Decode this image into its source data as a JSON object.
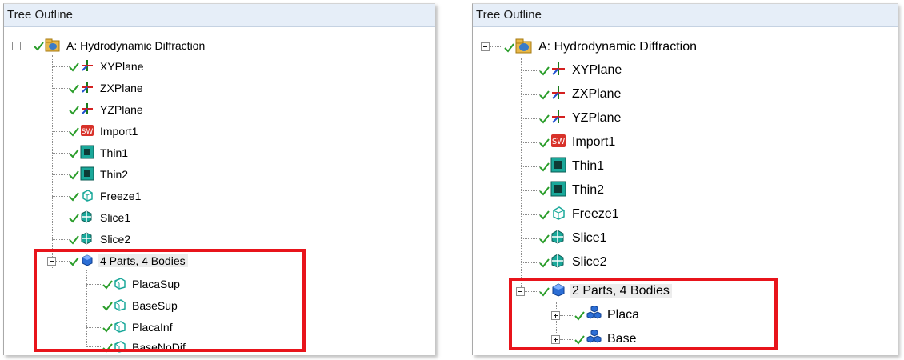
{
  "left_panel": {
    "title": "Tree Outline",
    "root_label": "A: Hydrodynamic Diffraction",
    "items": [
      {
        "label": "XYPlane",
        "icon": "plane-axes-icon"
      },
      {
        "label": "ZXPlane",
        "icon": "plane-axes-icon"
      },
      {
        "label": "YZPlane",
        "icon": "plane-axes-icon"
      },
      {
        "label": "Import1",
        "icon": "import-icon"
      },
      {
        "label": "Thin1",
        "icon": "thin-icon"
      },
      {
        "label": "Thin2",
        "icon": "thin-icon"
      },
      {
        "label": "Freeze1",
        "icon": "freeze-icon"
      },
      {
        "label": "Slice1",
        "icon": "slice-icon"
      },
      {
        "label": "Slice2",
        "icon": "slice-icon"
      }
    ],
    "parts_label": "4 Parts, 4 Bodies",
    "bodies": [
      {
        "label": "PlacaSup",
        "icon": "surface-body-icon"
      },
      {
        "label": "BaseSup",
        "icon": "surface-body-icon"
      },
      {
        "label": "PlacaInf",
        "icon": "surface-body-icon"
      },
      {
        "label": "BaseNoDif",
        "icon": "surface-body-icon"
      }
    ]
  },
  "right_panel": {
    "title": "Tree Outline",
    "root_label": "A: Hydrodynamic Diffraction",
    "items": [
      {
        "label": "XYPlane",
        "icon": "plane-axes-icon"
      },
      {
        "label": "ZXPlane",
        "icon": "plane-axes-icon"
      },
      {
        "label": "YZPlane",
        "icon": "plane-axes-icon"
      },
      {
        "label": "Import1",
        "icon": "import-icon"
      },
      {
        "label": "Thin1",
        "icon": "thin-icon"
      },
      {
        "label": "Thin2",
        "icon": "thin-icon"
      },
      {
        "label": "Freeze1",
        "icon": "freeze-icon"
      },
      {
        "label": "Slice1",
        "icon": "slice-icon"
      },
      {
        "label": "Slice2",
        "icon": "slice-icon"
      }
    ],
    "parts_label": "2 Parts, 4 Bodies",
    "bodies": [
      {
        "label": "Placa",
        "icon": "multi-body-part-icon"
      },
      {
        "label": "Base",
        "icon": "multi-body-part-icon"
      }
    ]
  },
  "colors": {
    "highlight": "#e8141b",
    "header_bg": "#e6eef8",
    "check": "#2a9d2a"
  }
}
